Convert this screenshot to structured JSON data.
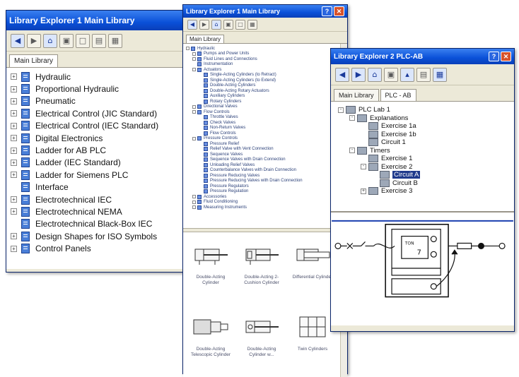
{
  "win1": {
    "title": "Library Explorer 1 Main Library",
    "tab": "Main Library",
    "items": [
      {
        "label": "Hydraulic",
        "expander": "+"
      },
      {
        "label": "Proportional Hydraulic",
        "expander": "+"
      },
      {
        "label": "Pneumatic",
        "expander": "+"
      },
      {
        "label": "Electrical Control (JIC Standard)",
        "expander": "+"
      },
      {
        "label": "Electrical Control (IEC Standard)",
        "expander": "+"
      },
      {
        "label": "Digital Electronics",
        "expander": "+"
      },
      {
        "label": "Ladder for AB PLC",
        "expander": "+"
      },
      {
        "label": "Ladder (IEC Standard)",
        "expander": "+"
      },
      {
        "label": "Ladder for Siemens PLC",
        "expander": "+"
      },
      {
        "label": "Interface",
        "expander": ""
      },
      {
        "label": "Electrotechnical IEC",
        "expander": "+"
      },
      {
        "label": "Electrotechnical NEMA",
        "expander": "+"
      },
      {
        "label": "Electrotechnical Black-Box IEC",
        "expander": ""
      },
      {
        "label": "Design Shapes for ISO Symbols",
        "expander": "+"
      },
      {
        "label": "Control Panels",
        "expander": "+"
      }
    ]
  },
  "win2": {
    "title": "Library Explorer 1 Main Library",
    "tab": "Main Library",
    "tree": [
      {
        "label": "Hydraulic",
        "indent": 0,
        "expander": "-"
      },
      {
        "label": "Pumps and Power Units",
        "indent": 1,
        "expander": "+"
      },
      {
        "label": "Fluid Lines and Connections",
        "indent": 1,
        "expander": "+"
      },
      {
        "label": "Instrumentation",
        "indent": 1,
        "expander": ""
      },
      {
        "label": "Actuators",
        "indent": 1,
        "expander": "-"
      },
      {
        "label": "Single-Acting Cylinders (to Retract)",
        "indent": 2,
        "expander": ""
      },
      {
        "label": "Single-Acting Cylinders (to Extend)",
        "indent": 2,
        "expander": ""
      },
      {
        "label": "Double-Acting Cylinders",
        "indent": 2,
        "expander": ""
      },
      {
        "label": "Double-Acting Rotary Actuators",
        "indent": 2,
        "expander": ""
      },
      {
        "label": "Auxiliary Cylinders",
        "indent": 2,
        "expander": ""
      },
      {
        "label": "Rotary Cylinders",
        "indent": 2,
        "expander": ""
      },
      {
        "label": "Directional Valves",
        "indent": 1,
        "expander": "+"
      },
      {
        "label": "Flow Controls",
        "indent": 1,
        "expander": "-"
      },
      {
        "label": "Throttle Valves",
        "indent": 2,
        "expander": ""
      },
      {
        "label": "Check Valves",
        "indent": 2,
        "expander": ""
      },
      {
        "label": "Non-Return Valves",
        "indent": 2,
        "expander": ""
      },
      {
        "label": "Flow Controls",
        "indent": 2,
        "expander": ""
      },
      {
        "label": "Pressure Controls",
        "indent": 1,
        "expander": "-"
      },
      {
        "label": "Pressure Relief",
        "indent": 2,
        "expander": ""
      },
      {
        "label": "Relief Valve with Vent Connection",
        "indent": 2,
        "expander": ""
      },
      {
        "label": "Sequence Valves",
        "indent": 2,
        "expander": ""
      },
      {
        "label": "Sequence Valves with Drain Connection",
        "indent": 2,
        "expander": ""
      },
      {
        "label": "Unloading Relief Valves",
        "indent": 2,
        "expander": ""
      },
      {
        "label": "Counterbalance Valves with Drain Connection",
        "indent": 2,
        "expander": ""
      },
      {
        "label": "Pressure Reducing Valves",
        "indent": 2,
        "expander": ""
      },
      {
        "label": "Pressure Reducing Valves with Drain Connection",
        "indent": 2,
        "expander": ""
      },
      {
        "label": "Pressure Regulators",
        "indent": 2,
        "expander": ""
      },
      {
        "label": "Pressure Regulation",
        "indent": 2,
        "expander": ""
      },
      {
        "label": "Accessories",
        "indent": 1,
        "expander": "+"
      },
      {
        "label": "Fluid Conditioning",
        "indent": 1,
        "expander": "+"
      },
      {
        "label": "Measuring Instruments",
        "indent": 1,
        "expander": "+"
      }
    ],
    "components": [
      {
        "label": "Double-Acting Cylinder"
      },
      {
        "label": "Double-Acting 2-Cushion Cylinder"
      },
      {
        "label": "Differential Cylinder"
      },
      {
        "label": "Double-Acting Telescopic Cylinder"
      },
      {
        "label": "Double-Acting Cylinder w..."
      },
      {
        "label": "Twin Cylinders"
      }
    ]
  },
  "win3": {
    "title": "Library Explorer 2 PLC-AB",
    "tabs": [
      "Main Library",
      "PLC - AB"
    ],
    "tree": [
      {
        "label": "PLC Lab 1",
        "indent": 0,
        "expander": "-",
        "selected": false
      },
      {
        "label": "Explanations",
        "indent": 1,
        "expander": "-",
        "selected": false
      },
      {
        "label": "Exercise 1a",
        "indent": 2,
        "expander": "",
        "selected": false
      },
      {
        "label": "Exercise 1b",
        "indent": 2,
        "expander": "",
        "selected": false
      },
      {
        "label": "Circuit 1",
        "indent": 2,
        "expander": "",
        "selected": false
      },
      {
        "label": "Timers",
        "indent": 1,
        "expander": "-",
        "selected": false
      },
      {
        "label": "Exercise 1",
        "indent": 2,
        "expander": "",
        "selected": false
      },
      {
        "label": "Exercise 2",
        "indent": 2,
        "expander": "-",
        "selected": false
      },
      {
        "label": "Circuit A",
        "indent": 3,
        "expander": "",
        "selected": true
      },
      {
        "label": "Circuit B",
        "indent": 3,
        "expander": "",
        "selected": false
      },
      {
        "label": "Exercise 3",
        "indent": 2,
        "expander": "+",
        "selected": false
      }
    ]
  }
}
